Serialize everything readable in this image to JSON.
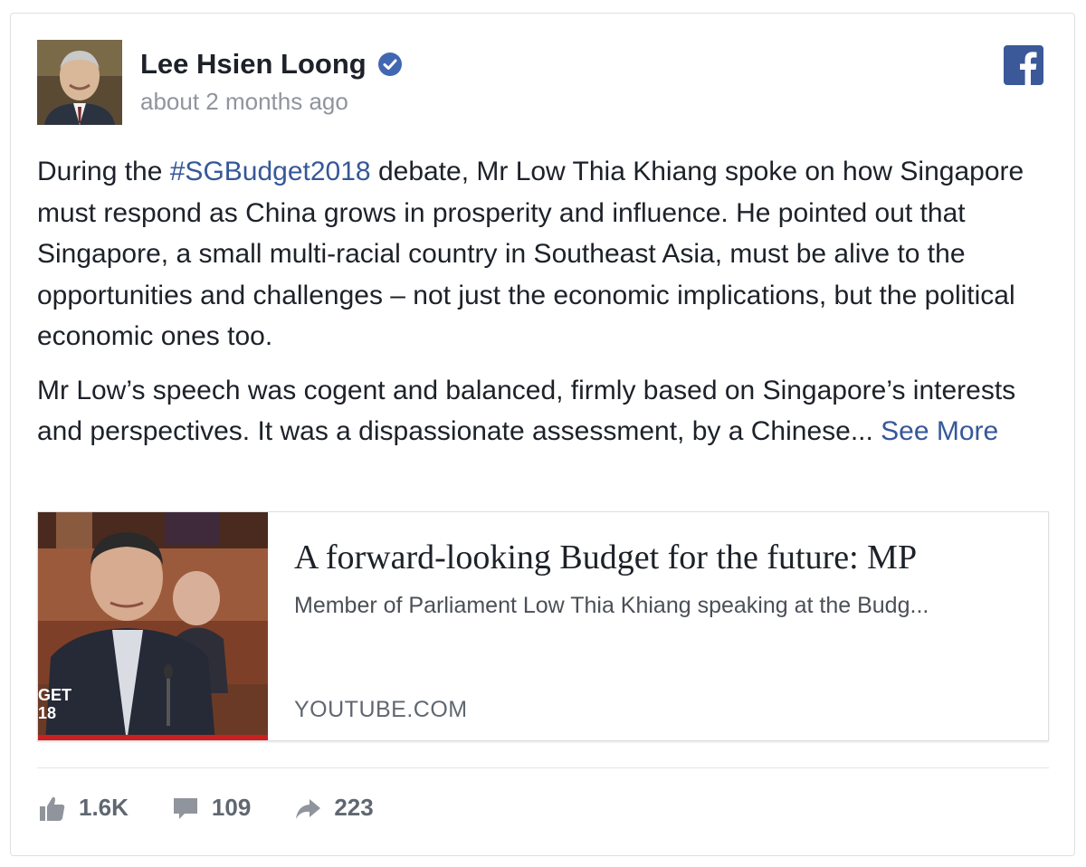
{
  "post": {
    "author": "Lee Hsien Loong",
    "verified_icon": "verified-badge-icon",
    "timestamp": "about 2 months ago",
    "platform_icon": "facebook-icon",
    "paragraph1": {
      "before": "During the ",
      "hashtag": "#SGBudget2018",
      "after": " debate, Mr Low Thia Khiang spoke on how Singapore must respond as China grows in prosperity and influence. He pointed out that Singapore, a small multi-racial country in Southeast Asia, must be alive to the opportunities and challenges – not just the economic implications, but the political economic ones too."
    },
    "paragraph2": {
      "text": "Mr Low’s speech was cogent and balanced, firmly based on Singapore’s interests and perspectives. It was a dispassionate assessment, by a Chinese...",
      "see_more": "See More"
    }
  },
  "link_preview": {
    "title": "A forward-looking Budget for the future: MP",
    "description": "Member of Parliament Low Thia Khiang speaking at the Budg...",
    "domain": "YOUTUBE.COM",
    "thumb_caption": "GET\n18"
  },
  "stats": {
    "likes": "1.6K",
    "comments": "109",
    "shares": "223"
  },
  "colors": {
    "link": "#365899",
    "verified": "#4267b2",
    "facebook": "#3b5998",
    "muted": "#90949c"
  }
}
